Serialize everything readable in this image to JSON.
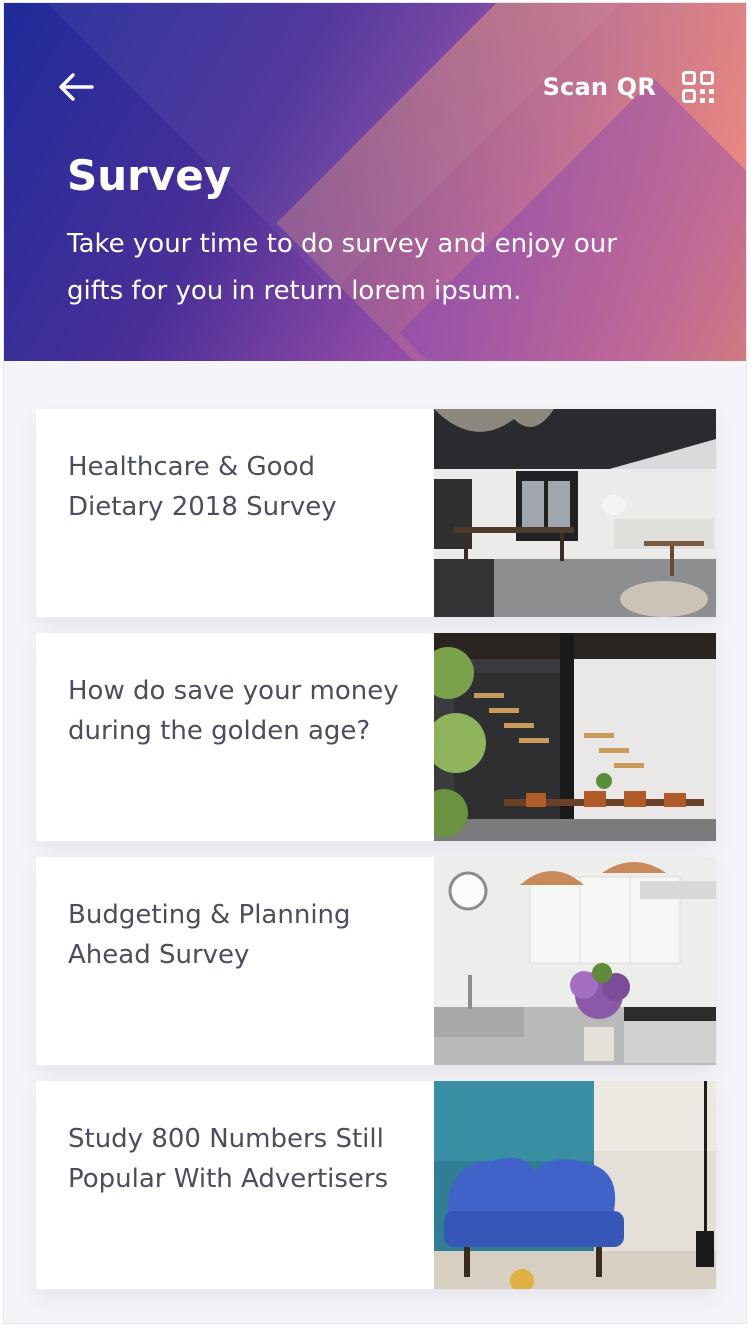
{
  "header": {
    "scan_label": "Scan QR",
    "title": "Survey",
    "subtitle": "Take your time to do survey and enjoy our gifts for you in return lorem ipsum."
  },
  "icons": {
    "back": "arrow-left-icon",
    "qr": "qr-code-icon"
  },
  "colors": {
    "gradient_start": "#1e2b9a",
    "gradient_end": "#ff9a5c",
    "card_text": "#4b4e5e",
    "background": "#f5f5f9"
  },
  "surveys": [
    {
      "title": "Healthcare & Good Dietary 2018 Survey",
      "image": "interior-dining-photo"
    },
    {
      "title": "How do save your money during the golden age?",
      "image": "staircase-dining-photo"
    },
    {
      "title": "Budgeting & Planning Ahead Survey",
      "image": "kitchen-photo"
    },
    {
      "title": "Study 800 Numbers Still Popular With Advertisers",
      "image": "blue-sofa-photo"
    }
  ]
}
